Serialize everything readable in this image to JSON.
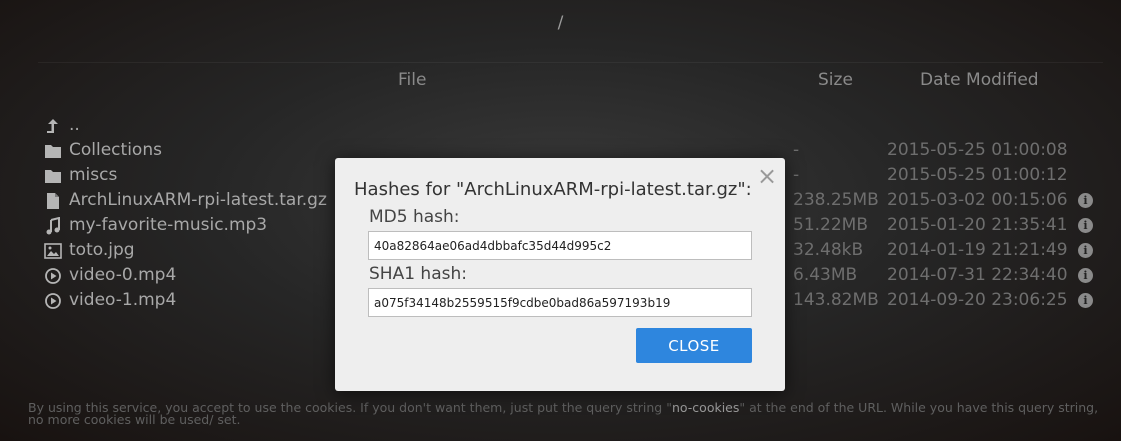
{
  "header": {
    "path": "/"
  },
  "table": {
    "col_file": "File",
    "col_size": "Size",
    "col_date": "Date Modified"
  },
  "rows": [
    {
      "icon": "parent-dir-icon",
      "name": "..",
      "size": "",
      "date": "",
      "info": false
    },
    {
      "icon": "folder-icon",
      "name": "Collections",
      "size": "-",
      "date": "2015-05-25 01:00:08",
      "info": false
    },
    {
      "icon": "folder-icon",
      "name": "miscs",
      "size": "-",
      "date": "2015-05-25 01:00:12",
      "info": false
    },
    {
      "icon": "file-icon",
      "name": "ArchLinuxARM-rpi-latest.tar.gz",
      "size": "238.25MB",
      "date": "2015-03-02 00:15:06",
      "info": true
    },
    {
      "icon": "music-icon",
      "name": "my-favorite-music.mp3",
      "size": "51.22MB",
      "date": "2015-01-20 21:35:41",
      "info": true
    },
    {
      "icon": "image-icon",
      "name": "toto.jpg",
      "size": "32.48kB",
      "date": "2014-01-19 21:21:49",
      "info": true
    },
    {
      "icon": "play-icon",
      "name": "video-0.mp4",
      "size": "6.43MB",
      "date": "2014-07-31 22:34:40",
      "info": true
    },
    {
      "icon": "play-icon",
      "name": "video-1.mp4",
      "size": "143.82MB",
      "date": "2014-09-20 23:06:25",
      "info": true
    }
  ],
  "info_glyph": "i",
  "cookie": {
    "before": "By using this service, you accept to use the cookies. If you don't want them, just put the query string \"",
    "code": "no-cookies",
    "after": "\" at the end of the URL. While you have this query string, no more cookies will be used/ set."
  },
  "modal": {
    "title": "Hashes for \"ArchLinuxARM-rpi-latest.tar.gz\":",
    "md5_label": "MD5 hash:",
    "md5_value": "40a82864ae06ad4dbbafc35d44d995c2",
    "sha1_label": "SHA1 hash:",
    "sha1_value": "a075f34148b2559515f9cdbe0bad86a597193b19",
    "close_label": "CLOSE",
    "close_glyph": "×"
  }
}
